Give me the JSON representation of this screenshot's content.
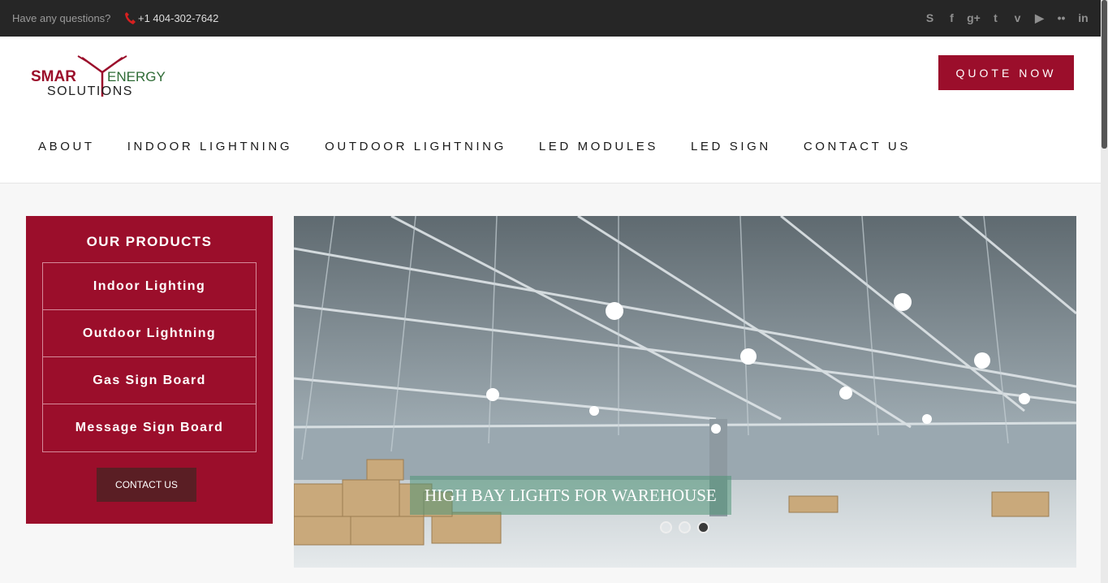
{
  "topbar": {
    "questions": "Have any questions?",
    "phone": "+1 404-302-7642",
    "social": [
      {
        "name": "skype-icon",
        "glyph": "S"
      },
      {
        "name": "facebook-icon",
        "glyph": "f"
      },
      {
        "name": "google-plus-icon",
        "glyph": "g+"
      },
      {
        "name": "twitter-icon",
        "glyph": "t"
      },
      {
        "name": "vimeo-icon",
        "glyph": "v"
      },
      {
        "name": "youtube-icon",
        "glyph": "▶"
      },
      {
        "name": "flickr-icon",
        "glyph": "••"
      },
      {
        "name": "linkedin-icon",
        "glyph": "in"
      }
    ]
  },
  "logo": {
    "line1_left": "SMAR",
    "line1_right": "ENERGY",
    "line2": "SOLUTIONS"
  },
  "header": {
    "quote_label": "QUOTE NOW",
    "nav": [
      "ABOUT",
      "INDOOR LIGHTNING",
      "OUTDOOR LIGHTNING",
      "LED MODULES",
      "LED SIGN",
      "CONTACT US"
    ]
  },
  "sidebar": {
    "title": "OUR PRODUCTS",
    "items": [
      "Indoor Lighting",
      "Outdoor Lightning",
      "Gas Sign Board",
      "Message Sign Board"
    ],
    "contact_label": "CONTACT US"
  },
  "slider": {
    "caption": "HIGH BAY LIGHTS FOR WAREHOUSE",
    "slides": 3,
    "active": 3
  },
  "colors": {
    "brand": "#9b0e2b",
    "dark": "#262626",
    "contact": "#5a1e24"
  }
}
